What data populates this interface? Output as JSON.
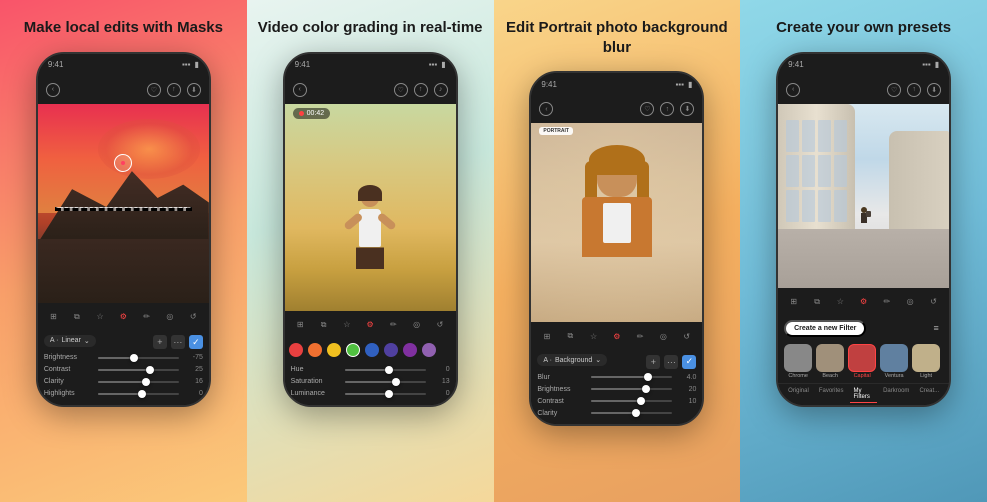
{
  "panels": [
    {
      "id": "panel-1",
      "title": "Make local edits\nwith Masks",
      "adjustments": {
        "tag": "Linear",
        "items": [
          {
            "label": "Brightness",
            "value": "-75",
            "fill_pct": 40
          },
          {
            "label": "Contrast",
            "value": "25",
            "fill_pct": 60
          },
          {
            "label": "Clarity",
            "value": "16",
            "fill_pct": 55
          },
          {
            "label": "Highlights",
            "value": "0",
            "fill_pct": 50
          }
        ]
      }
    },
    {
      "id": "panel-2",
      "title": "Video color grading\nin real-time",
      "video_time": "00:42",
      "adjustments": {
        "items": [
          {
            "label": "Hue",
            "value": "0",
            "fill_pct": 50
          },
          {
            "label": "Saturation",
            "value": "13",
            "fill_pct": 58
          },
          {
            "label": "Luminance",
            "value": "0",
            "fill_pct": 50
          }
        ]
      },
      "colors": [
        {
          "color": "#e84040",
          "active": false
        },
        {
          "color": "#f07030",
          "active": false
        },
        {
          "color": "#f0c020",
          "active": false
        },
        {
          "color": "#50c040",
          "active": true
        },
        {
          "color": "#3060c0",
          "active": false
        },
        {
          "color": "#5040a0",
          "active": false
        },
        {
          "color": "#8030a0",
          "active": false
        },
        {
          "color": "#9060b0",
          "active": false
        }
      ]
    },
    {
      "id": "panel-3",
      "title": "Edit Portrait photo\nbackground blur",
      "tag_label": "PORTRAIT",
      "adjustments": {
        "tag": "Background",
        "items": [
          {
            "label": "Blur",
            "value": "4.0",
            "fill_pct": 65
          },
          {
            "label": "Brightness",
            "value": "20",
            "fill_pct": 62
          },
          {
            "label": "Contrast",
            "value": "10",
            "fill_pct": 56
          },
          {
            "label": "Clarity",
            "value": "",
            "fill_pct": 50
          }
        ]
      }
    },
    {
      "id": "panel-4",
      "title": "Create your\nown presets",
      "create_filter_btn": "Create a new Filter",
      "presets": [
        {
          "label": "Chrome",
          "color": "#888"
        },
        {
          "label": "Beach",
          "color": "#a0907a"
        },
        {
          "label": "Capital",
          "color": "#c04040",
          "active": true
        },
        {
          "label": "Ventura",
          "color": "#6080a0"
        },
        {
          "label": "Light",
          "color": "#c0b08a"
        }
      ],
      "preset_tabs": [
        "Original",
        "Favorites",
        "My Filters",
        "Darkroom",
        "Creat..."
      ]
    }
  ],
  "toolbar_icons": [
    "grid",
    "copy",
    "star",
    "tune",
    "pen",
    "bulb",
    "history"
  ],
  "nav_icons": [
    "chevron-left",
    "heart",
    "share",
    "download"
  ]
}
